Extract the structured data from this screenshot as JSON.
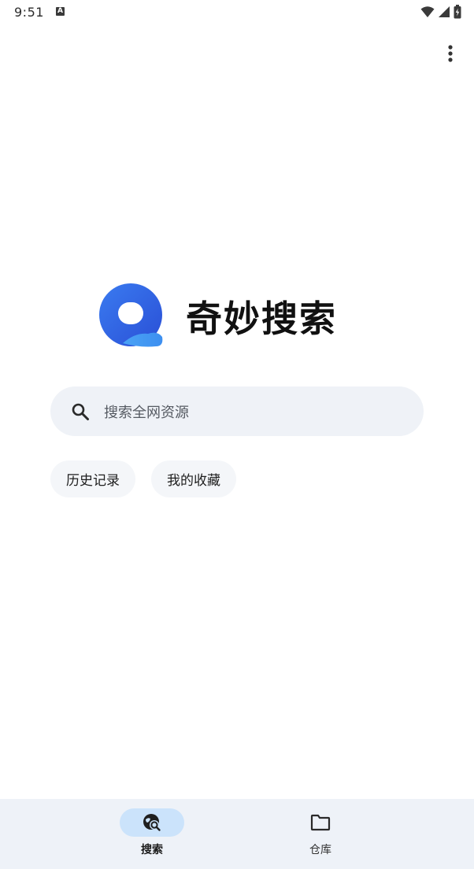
{
  "status_bar": {
    "time": "9:51",
    "notification_icon": "A"
  },
  "app": {
    "title": "奇妙搜索"
  },
  "search": {
    "placeholder": "搜索全网资源"
  },
  "chips": [
    {
      "label": "历史记录"
    },
    {
      "label": "我的收藏"
    }
  ],
  "bottom_nav": {
    "items": [
      {
        "label": "搜索",
        "icon": "search-globe-icon",
        "active": true
      },
      {
        "label": "仓库",
        "icon": "folder-icon",
        "active": false
      }
    ]
  },
  "colors": {
    "accent": "#2b6fe8",
    "search_bg": "#eff2f7",
    "nav_bg": "#eef2f8",
    "nav_active": "#cbe3fb"
  }
}
